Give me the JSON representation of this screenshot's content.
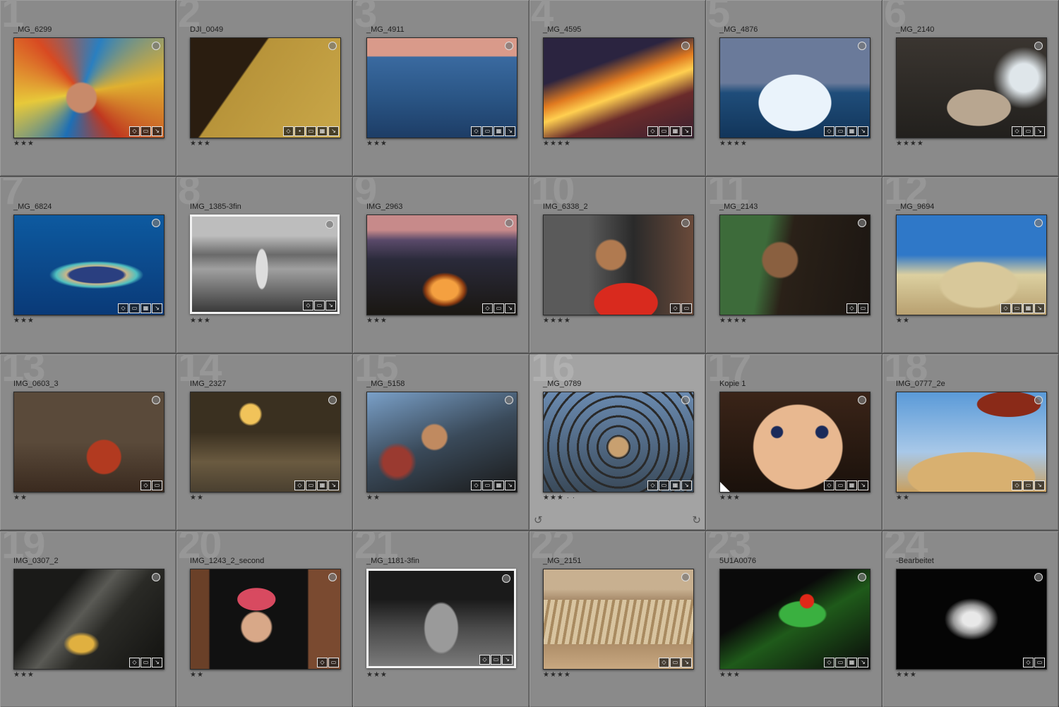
{
  "photos": [
    {
      "index": "1",
      "name": "_MG_6299",
      "stars": "★★★",
      "badges": [
        "◇",
        "▭",
        "↘"
      ]
    },
    {
      "index": "2",
      "name": "DJI_0049",
      "stars": "★★★",
      "badges": [
        "◇",
        "▪",
        "▭",
        "▦",
        "↘"
      ]
    },
    {
      "index": "3",
      "name": "_MG_4911",
      "stars": "★★★",
      "badges": [
        "◇",
        "▭",
        "▦",
        "↘"
      ]
    },
    {
      "index": "4",
      "name": "_MG_4595",
      "stars": "★★★★",
      "badges": [
        "◇",
        "▭",
        "▦",
        "↘"
      ]
    },
    {
      "index": "5",
      "name": "_MG_4876",
      "stars": "★★★★",
      "badges": [
        "◇",
        "▭",
        "▦",
        "↘"
      ]
    },
    {
      "index": "6",
      "name": "_MG_2140",
      "stars": "★★★★",
      "badges": [
        "◇",
        "▭",
        "↘"
      ]
    },
    {
      "index": "7",
      "name": "_MG_6824",
      "stars": "★★★",
      "badges": [
        "◇",
        "▭",
        "▦",
        "↘"
      ]
    },
    {
      "index": "8",
      "name": "IMG_1385-3fin",
      "stars": "★★★",
      "badges": [
        "◇",
        "▭",
        "↘"
      ]
    },
    {
      "index": "9",
      "name": "IMG_2963",
      "stars": "★★★",
      "badges": [
        "◇",
        "▭",
        "↘"
      ]
    },
    {
      "index": "10",
      "name": "IMG_6338_2",
      "stars": "★★★★",
      "badges": [
        "◇",
        "▭"
      ]
    },
    {
      "index": "11",
      "name": "_MG_2143",
      "stars": "★★★★",
      "badges": [
        "◇",
        "▭"
      ]
    },
    {
      "index": "12",
      "name": "_MG_9694",
      "stars": "★★",
      "badges": [
        "◇",
        "▭",
        "▦",
        "↘"
      ]
    },
    {
      "index": "13",
      "name": "IMG_0603_3",
      "stars": "★★",
      "badges": [
        "◇",
        "▭"
      ]
    },
    {
      "index": "14",
      "name": "IMG_2327",
      "stars": "★★",
      "badges": [
        "◇",
        "▭",
        "▦",
        "↘"
      ]
    },
    {
      "index": "15",
      "name": "_MG_5158",
      "stars": "★★",
      "badges": [
        "◇",
        "▭",
        "▦",
        "↘"
      ]
    },
    {
      "index": "16",
      "name": "_MG_0789",
      "stars": "★★★ · ·",
      "badges": [
        "◇",
        "▭",
        "▦",
        "↘"
      ],
      "selected": true
    },
    {
      "index": "17",
      "name": "Kopie 1",
      "stars": "★★★",
      "badges": [
        "◇",
        "▭",
        "▦",
        "↘"
      ]
    },
    {
      "index": "18",
      "name": "IMG_0777_2e",
      "stars": "★★",
      "badges": [
        "◇",
        "▭",
        "↘"
      ]
    },
    {
      "index": "19",
      "name": "IMG_0307_2",
      "stars": "★★★",
      "badges": [
        "◇",
        "▭",
        "↘"
      ]
    },
    {
      "index": "20",
      "name": "IMG_1243_2_second",
      "stars": "★★",
      "badges": [
        "◇",
        "▭"
      ]
    },
    {
      "index": "21",
      "name": "_MG_1181-3fin",
      "stars": "★★★",
      "badges": [
        "◇",
        "▭",
        "↘"
      ]
    },
    {
      "index": "22",
      "name": "_MG_2151",
      "stars": "★★★★",
      "badges": [
        "◇",
        "▭",
        "↘"
      ]
    },
    {
      "index": "23",
      "name": "5U1A0076",
      "stars": "★★★",
      "badges": [
        "◇",
        "▭",
        "▦",
        "↘"
      ]
    },
    {
      "index": "24",
      "name": "-Bearbeitet",
      "stars": "★★★",
      "badges": [
        "◇",
        "▭"
      ]
    }
  ],
  "rotate_left_glyph": "↺",
  "rotate_right_glyph": "↻"
}
